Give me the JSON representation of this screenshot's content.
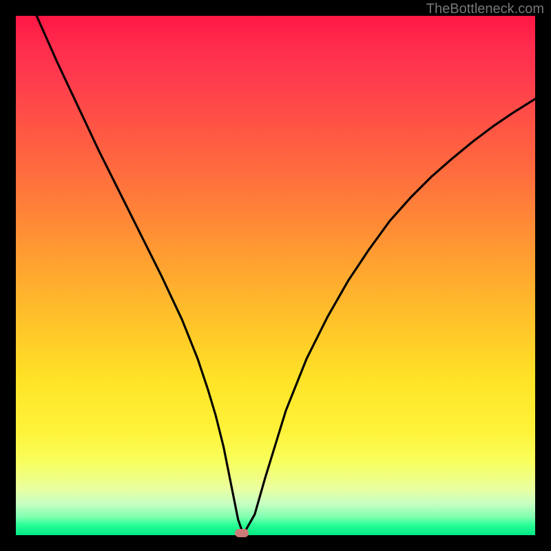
{
  "watermark": {
    "text": "TheBottleneck.com"
  },
  "chart_data": {
    "type": "line",
    "title": "",
    "xlabel": "",
    "ylabel": "",
    "xlim": [
      0,
      100
    ],
    "ylim": [
      0,
      100
    ],
    "grid": false,
    "legend": false,
    "series": [
      {
        "name": "bottleneck-curve",
        "x": [
          4,
          8,
          12,
          16,
          20,
          24,
          28,
          32,
          35,
          37,
          38.5,
          40,
          41,
          42,
          42.8,
          43.5,
          44,
          46,
          48,
          52,
          56,
          60,
          64,
          68,
          72,
          76,
          80,
          84,
          88,
          92,
          96,
          100
        ],
        "values": [
          100,
          91,
          82.5,
          74,
          66,
          58,
          50,
          41.5,
          34,
          28,
          23,
          17,
          12,
          7,
          3,
          1,
          0.5,
          4,
          11,
          24,
          34,
          42,
          49,
          55,
          60.5,
          65,
          69,
          72.5,
          75.8,
          78.8,
          81.5,
          84
        ]
      }
    ],
    "marker": {
      "x": 43.5,
      "y": 0.4,
      "color": "#cc7a78"
    },
    "background_gradient": {
      "top": "#ff1744",
      "mid": "#ffe326",
      "bottom": "#00e884"
    }
  }
}
